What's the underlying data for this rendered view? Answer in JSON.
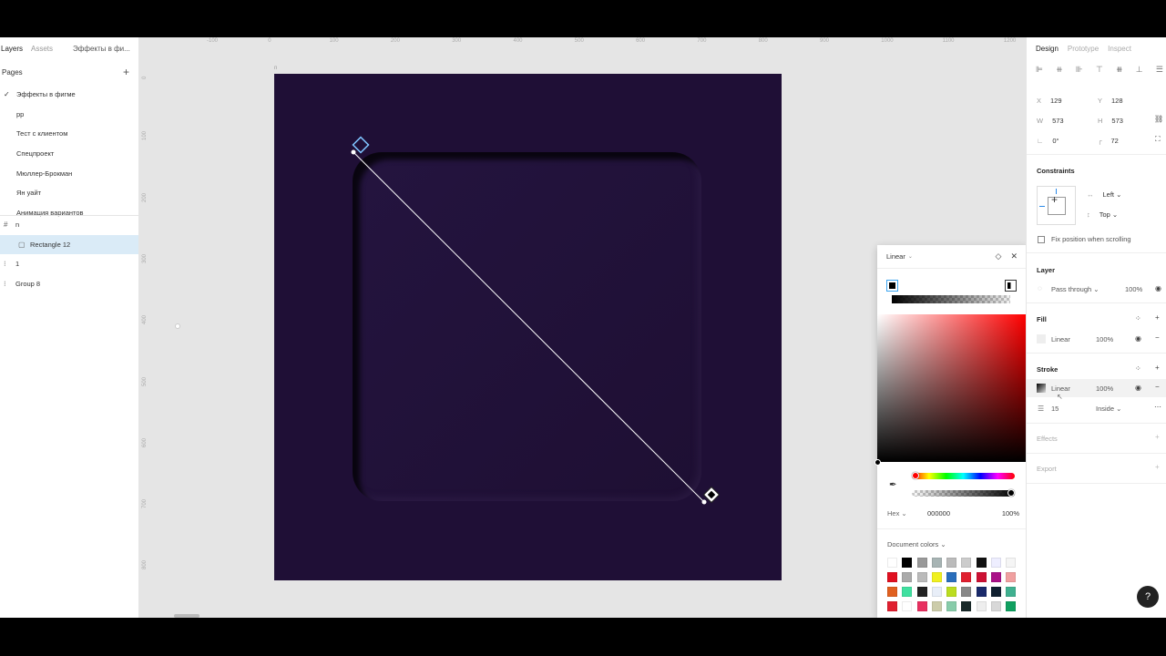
{
  "left_panel": {
    "tabs": {
      "layers": "Layers",
      "assets": "Assets",
      "page": "Эффекты в фи..."
    },
    "pages_title": "Pages",
    "pages": [
      "Эффекты в фигме",
      "pp",
      "Тест с клиентом",
      "Спецпроект",
      "Мюллер-Брокман",
      "Ян уайт",
      "Анимация вариантов"
    ],
    "layers": [
      {
        "name": "n",
        "icon": "frame-icon"
      },
      {
        "name": "Rectangle 12",
        "icon": "rectangle-icon",
        "selected": true
      },
      {
        "name": "1",
        "icon": "frame-icon"
      },
      {
        "name": "Group 8",
        "icon": "group-icon"
      }
    ]
  },
  "canvas": {
    "frame_label": "n",
    "ruler_top": [
      "-100",
      "0",
      "100",
      "200",
      "300",
      "400",
      "500",
      "600",
      "700",
      "800",
      "900",
      "1000",
      "1100",
      "1200"
    ],
    "ruler_left": [
      "0",
      "100",
      "200",
      "300",
      "400",
      "500",
      "600",
      "700",
      "800"
    ],
    "frame_color": "#1f0f36"
  },
  "picker": {
    "mode": "Linear",
    "hex_label": "Hex",
    "hex_value": "000000",
    "opacity": "100%",
    "document_colors_label": "Document colors",
    "swatches": [
      "#ffffff",
      "#000000",
      "#999999",
      "#a7b4b4",
      "#bbbbbb",
      "#cccccc",
      "#111111",
      "#eeeeff",
      "#f5f5f5",
      "#e01020",
      "#aaaaaa",
      "#bbbbbb",
      "#f0f020",
      "#2a6ebb",
      "#e02030",
      "#cc1133",
      "#aa1188",
      "#f0a0a0",
      "#e06020",
      "#40e0a0",
      "#222222",
      "#e8eef8",
      "#bbdd20",
      "#888888",
      "#1a2a6a",
      "#102030",
      "#40b090",
      "#e02030",
      "#ffffff",
      "#e83060",
      "#ccccaa",
      "#88ccaa",
      "#1a2a2a",
      "#eeeeee",
      "#d8d8d8",
      "#10a060"
    ]
  },
  "right_panel": {
    "tabs": {
      "design": "Design",
      "prototype": "Prototype",
      "inspect": "Inspect"
    },
    "x_label": "X",
    "x": "129",
    "y_label": "Y",
    "y": "128",
    "w_label": "W",
    "w": "573",
    "h_label": "H",
    "h": "573",
    "rotation": "0°",
    "radius": "72",
    "constraints_title": "Constraints",
    "constraint_h": "Left",
    "constraint_v": "Top",
    "fix_position": "Fix position when scrolling",
    "layer_title": "Layer",
    "blend": "Pass through",
    "layer_opacity": "100%",
    "fill_title": "Fill",
    "fill_type": "Linear",
    "fill_opacity": "100%",
    "stroke_title": "Stroke",
    "stroke_type": "Linear",
    "stroke_opacity": "100%",
    "stroke_weight": "15",
    "stroke_align": "Inside",
    "effects_title": "Effects",
    "export_title": "Export"
  },
  "help_label": "?"
}
